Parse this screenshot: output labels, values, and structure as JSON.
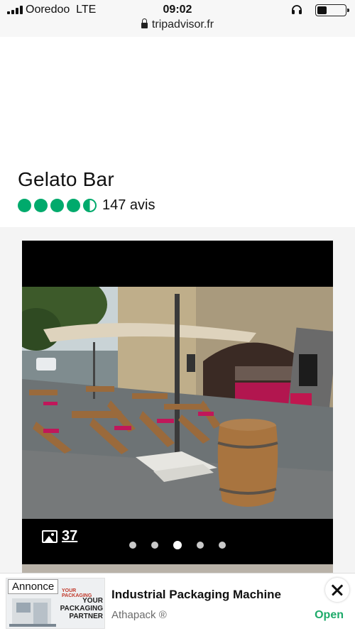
{
  "status_bar": {
    "carrier": "Ooredoo",
    "network": "LTE",
    "time": "09:02",
    "battery_level": 0.35,
    "icons": [
      "signal-icon",
      "headphones-icon",
      "battery-icon"
    ]
  },
  "browser": {
    "url": "tripadvisor.fr",
    "icon": "lock-icon"
  },
  "listing": {
    "name": "Gelato Bar",
    "rating": 4.5,
    "rating_max": 5,
    "reviews": "147 avis",
    "rating_color": "#00aa6c"
  },
  "gallery": {
    "photo_count": "37",
    "photo_icon": "image-icon",
    "dots_total": 5,
    "active_dot": 3
  },
  "ad": {
    "badge": "Annonce",
    "title": "Industrial Packaging Machine",
    "advertiser": "Athapack ®",
    "cta": "Open",
    "thumb_text_small": "YOUR PACKAGING",
    "thumb_text_big": "YOUR PACKAGING PARTNER",
    "cta_color": "#1eaa6a"
  }
}
